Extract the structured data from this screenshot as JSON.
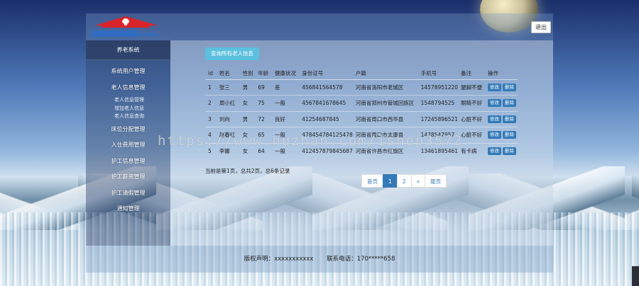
{
  "header": {
    "logout_label": "退出"
  },
  "sidebar": {
    "brand": "养老系统",
    "items": [
      {
        "label": "系统用户管理"
      },
      {
        "label": "老人信息管理",
        "sub": [
          "老人信息管理",
          "增加老人信息",
          "老人信息查询"
        ]
      },
      {
        "label": "床位分配管理"
      },
      {
        "label": "入住费用管理"
      },
      {
        "label": "护工信息管理"
      },
      {
        "label": "护工薪资管理"
      },
      {
        "label": "护工请假管理"
      },
      {
        "label": "通知管理"
      }
    ]
  },
  "main": {
    "query_button": "查询所有老人信息",
    "table": {
      "headers": [
        "id",
        "姓名",
        "性别",
        "年龄",
        "健康状况",
        "身份证号",
        "户籍",
        "手机号",
        "备注",
        "操作"
      ],
      "rows": [
        [
          "1",
          "张三",
          "男",
          "69",
          "差",
          "456841564578",
          "河南省洛阳市老城区",
          "14578951220",
          "腿脚不便"
        ],
        [
          "2",
          "周小红",
          "女",
          "75",
          "一般",
          "4567841678645",
          "河南省郑州市管城回族区",
          "1548794525",
          "眼睛不好"
        ],
        [
          "3",
          "刘向",
          "男",
          "72",
          "良好",
          "41254687845",
          "河南省周口市西华县",
          "17245896521",
          "心脏不好"
        ],
        [
          "4",
          "赵春红",
          "女",
          "65",
          "一般",
          "478454784125478",
          "河南省周口市太康县",
          "1478547957",
          "心脏不好"
        ],
        [
          "5",
          "李娜",
          "女",
          "64",
          "一般",
          "412457879845687",
          "河南省许昌市红旗区",
          "13461895461",
          "有卡病"
        ]
      ],
      "edit_label": "修改",
      "delete_label": "删除"
    },
    "record_info": "当前是第1页，总共2页，总6条记录",
    "pagination": [
      "首页",
      "1",
      "2",
      "»",
      "尾页"
    ],
    "pagination_active": "1"
  },
  "footer": {
    "copyright": "版权声明：xxxxxxxxxxx",
    "phone": "联系电话：170*****658"
  },
  "watermark": "https://www.huzhan.com/ishop3572",
  "colors": {
    "query_button": "#5bc0de",
    "primary": "#337ab7"
  }
}
